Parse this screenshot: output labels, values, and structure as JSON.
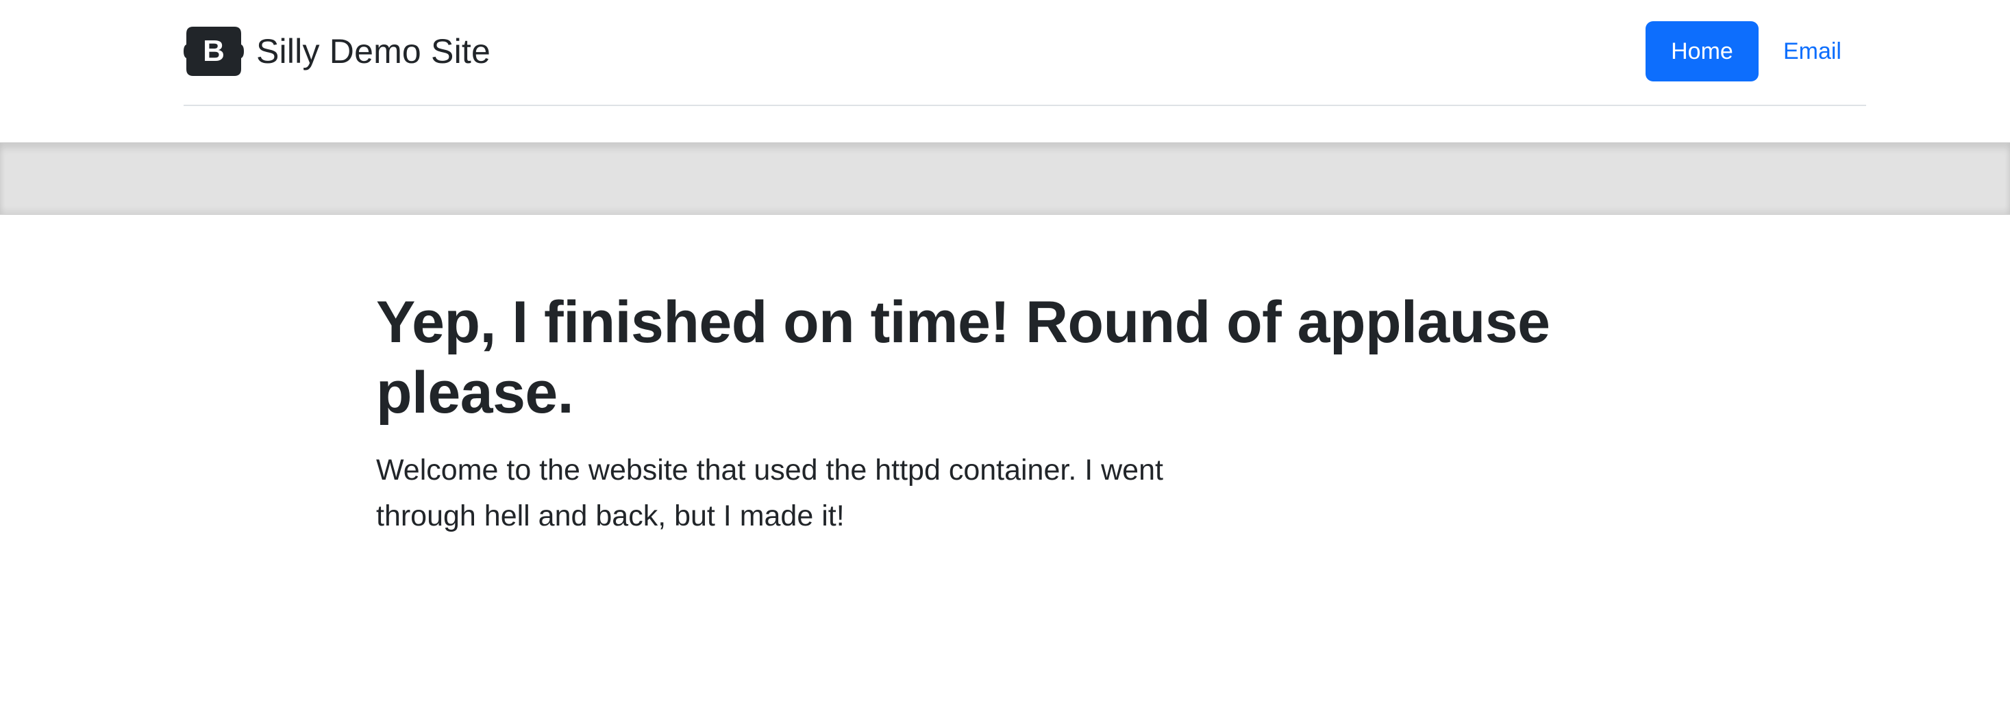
{
  "brand": {
    "logo_letter": "B",
    "name": "Silly Demo Site"
  },
  "nav": {
    "items": [
      {
        "label": "Home",
        "active": true
      },
      {
        "label": "Email",
        "active": false
      }
    ]
  },
  "hero": {
    "title": "Yep, I finished on time! Round of applause please.",
    "lead": "Welcome to the website that used the httpd container. I went through hell and back, but I made it!"
  },
  "colors": {
    "primary": "#0d6efd",
    "text": "#212529",
    "band": "#e2e2e2",
    "logo_bg": "#212529"
  }
}
